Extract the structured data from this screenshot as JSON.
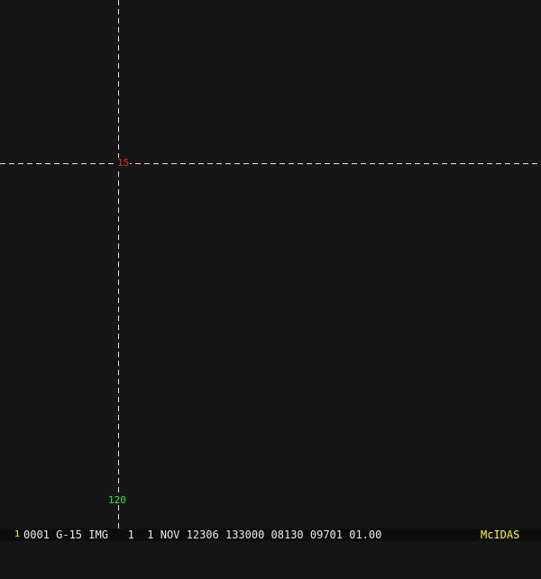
{
  "grid": {
    "latitude_label": "15",
    "longitude_label": "120",
    "line_color": "#33dddd",
    "lat_color": "#ff1a1a",
    "lon_color": "#22ee22"
  },
  "status_bar": {
    "frame_number": "1",
    "text": "0001 G-15 IMG   1  1 NOV 12306 133000 08130 09701 01.00",
    "brand": "McIDAS"
  }
}
